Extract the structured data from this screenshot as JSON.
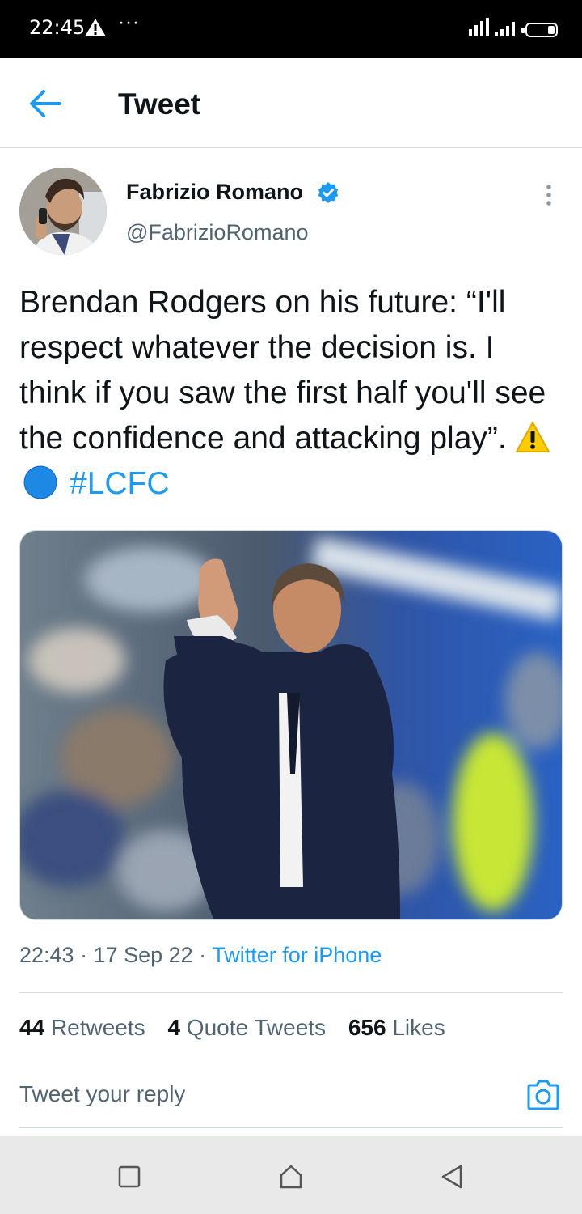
{
  "status_bar": {
    "time": "22:45",
    "dots": "···"
  },
  "header": {
    "title": "Tweet"
  },
  "tweet": {
    "author_name": "Fabrizio Romano",
    "author_handle": "@FabrizioRomano",
    "text": "Brendan Rodgers on his future: “I'll respect whatever the decision is. I think if you saw the first half you'll see the confidence and attacking play”.",
    "hashtag": "#LCFC",
    "timestamp": "22:43 · 17 Sep 22 ·",
    "source": "Twitter for iPhone"
  },
  "stats": {
    "retweets_count": "44",
    "retweets_label": "Retweets",
    "quotes_count": "4",
    "quotes_label": "Quote Tweets",
    "likes_count": "656",
    "likes_label": "Likes"
  },
  "reply": {
    "placeholder": "Tweet your reply"
  },
  "colors": {
    "accent": "#1d9bf0",
    "text": "#0f1419",
    "muted": "#536471"
  },
  "icons": {
    "back": "arrow-left-icon",
    "verified": "verified-badge-icon",
    "more": "more-vertical-icon",
    "camera": "camera-icon"
  }
}
